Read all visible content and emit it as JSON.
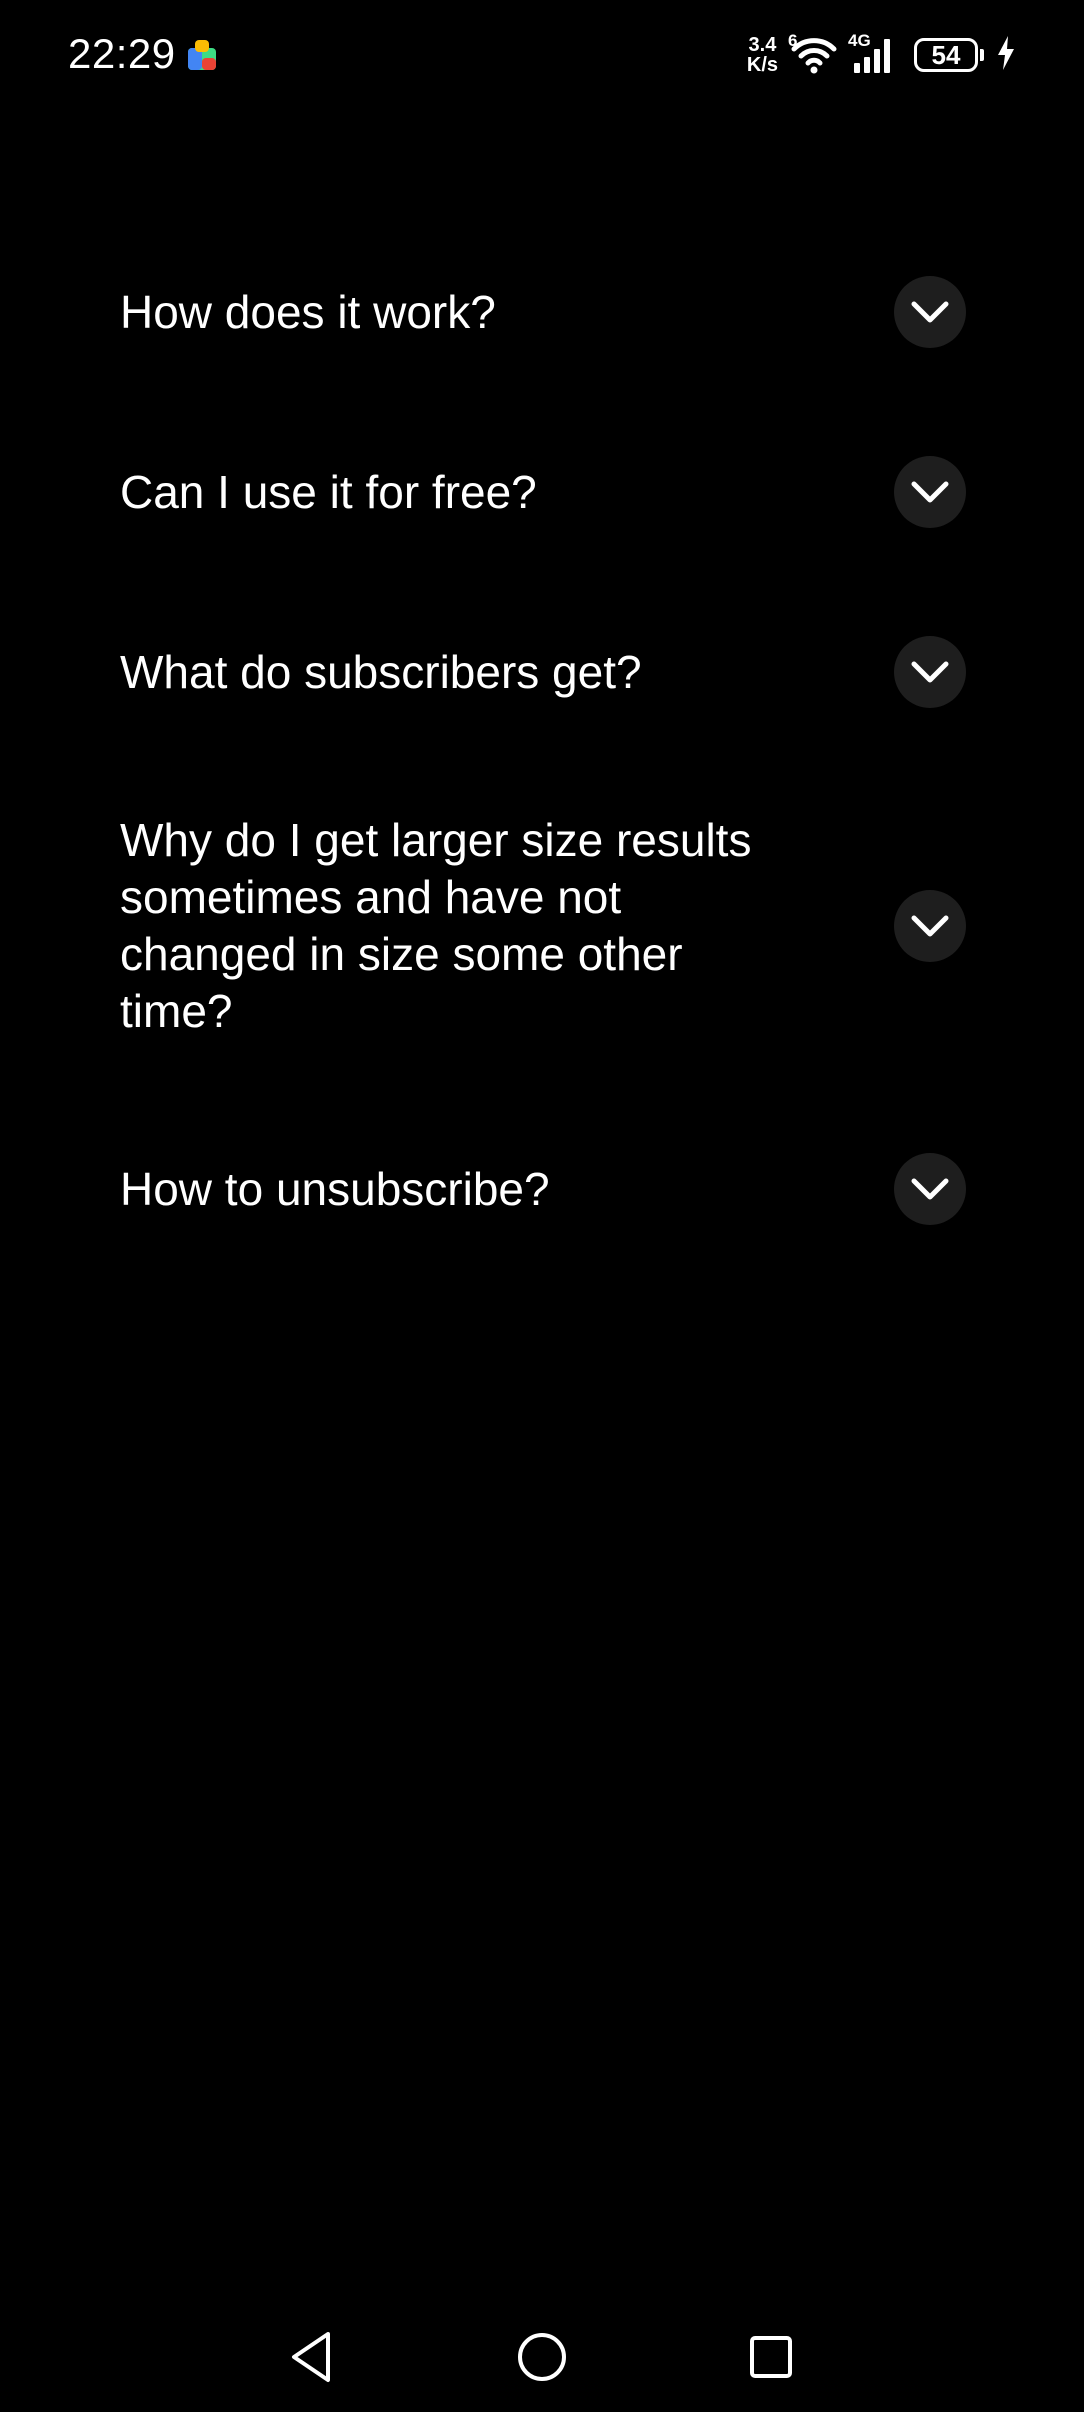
{
  "status_bar": {
    "time": "22:29",
    "net_speed_value": "3.4",
    "net_speed_unit": "K/s",
    "wifi_label": "6",
    "cell_label": "4G",
    "battery_level": "54"
  },
  "faq": {
    "items": [
      {
        "question": "How does it work?"
      },
      {
        "question": "Can I use it for free?"
      },
      {
        "question": "What do subscribers get?"
      },
      {
        "question": "Why do I get larger size results sometimes and have not changed in size some other time?"
      },
      {
        "question": "How to unsubscribe?"
      }
    ]
  },
  "colors": {
    "background": "#000000",
    "text": "#ffffff",
    "chevron_button_bg": "#1e1e1e"
  },
  "icons": {
    "expand": "chevron-down-icon",
    "nav_back": "back-triangle-icon",
    "nav_home": "home-circle-icon",
    "nav_recents": "recents-square-icon"
  }
}
